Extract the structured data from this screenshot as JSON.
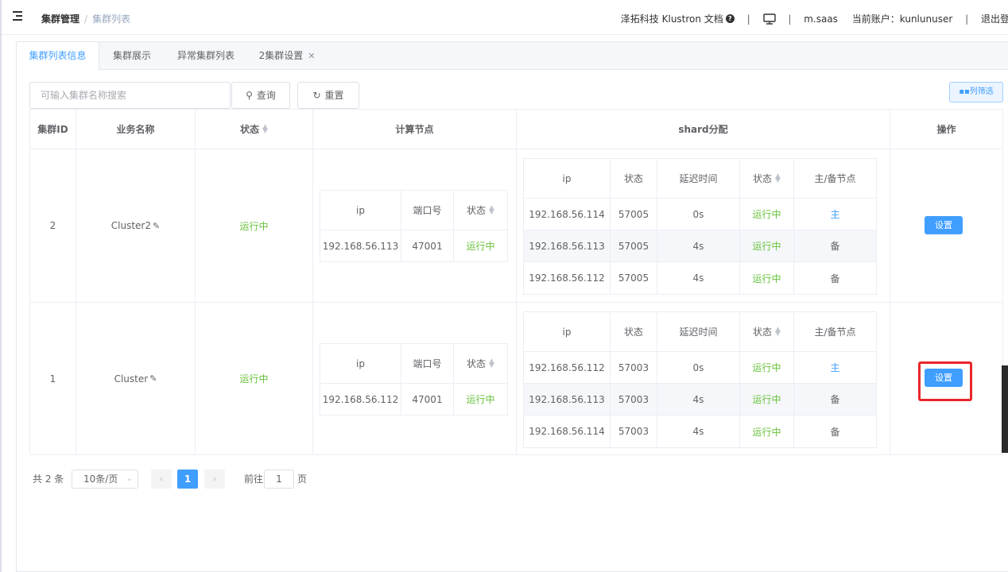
{
  "header": {
    "breadcrumb": [
      "集群管理",
      "集群列表"
    ],
    "separator": "/",
    "docs_label": "泽拓科技 Klustron 文档",
    "divider": "|",
    "server": "m.saas",
    "account_label": "当前账户：kunlunuser",
    "logout_label": "退出登"
  },
  "tabs": [
    {
      "label": "集群列表信息",
      "active": true
    },
    {
      "label": "集群展示",
      "active": false
    },
    {
      "label": "异常集群列表",
      "active": false
    },
    {
      "label": "2集群设置",
      "active": false,
      "closable": true
    }
  ],
  "toolbar": {
    "search_placeholder": "可输入集群名称搜索",
    "query_label": "查询",
    "reset_label": "重置",
    "column_filter_label": "列筛选"
  },
  "table": {
    "headers": [
      "集群ID",
      "业务名称",
      "状态",
      "计算节点",
      "shard分配",
      "操作"
    ],
    "compute_headers": [
      "ip",
      "端口号",
      "状态"
    ],
    "shard_headers": [
      "ip",
      "状态",
      "延迟时间",
      "状态",
      "主/备节点"
    ],
    "rows": [
      {
        "id": "2",
        "name": "Cluster2",
        "status": "运行中",
        "compute": {
          "ip": "192.168.56.113",
          "port": "47001",
          "status": "运行中"
        },
        "shards": [
          {
            "ip": "192.168.56.114",
            "port": "57005",
            "delay": "0s",
            "status": "运行中",
            "role": "主"
          },
          {
            "ip": "192.168.56.113",
            "port": "57005",
            "delay": "4s",
            "status": "运行中",
            "role": "备"
          },
          {
            "ip": "192.168.56.112",
            "port": "57005",
            "delay": "4s",
            "status": "运行中",
            "role": "备"
          }
        ],
        "action_label": "设置"
      },
      {
        "id": "1",
        "name": "Cluster",
        "status": "运行中",
        "compute": {
          "ip": "192.168.56.112",
          "port": "47001",
          "status": "运行中"
        },
        "shards": [
          {
            "ip": "192.168.56.112",
            "port": "57003",
            "delay": "0s",
            "status": "运行中",
            "role": "主"
          },
          {
            "ip": "192.168.56.113",
            "port": "57003",
            "delay": "4s",
            "status": "运行中",
            "role": "备"
          },
          {
            "ip": "192.168.56.114",
            "port": "57003",
            "delay": "4s",
            "status": "运行中",
            "role": "备"
          }
        ],
        "action_label": "设置"
      }
    ]
  },
  "pagination": {
    "total_label": "共 2 条",
    "page_size": "10条/页",
    "current_page": "1",
    "goto_label": "前往",
    "goto_value": "1",
    "page_unit": "页"
  },
  "colors": {
    "accent": "#409eff",
    "running": "#67c23a",
    "highlight": "#e8262a"
  }
}
